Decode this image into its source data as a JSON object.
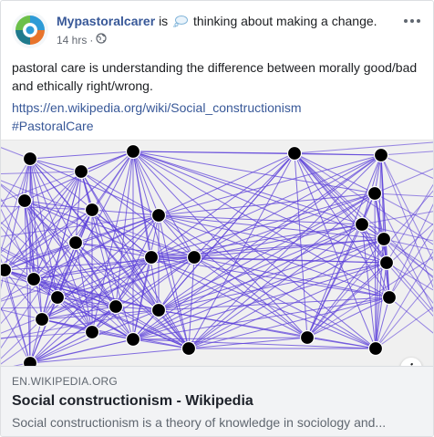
{
  "post": {
    "author": "Mypastoralcarer",
    "verb_is": "is",
    "feeling_emoji": "thought-balloon-icon",
    "feeling_text": "thinking about making a change.",
    "time": "14 hrs",
    "dot": "·",
    "privacy_icon": "globe-icon",
    "body": "pastoral care is understanding the difference between morally good/bad and ethically right/wrong.",
    "link_url": "https://en.wikipedia.org/wiki/Social_constructionism",
    "hashtag": "#PastoralCare"
  },
  "link_preview": {
    "domain": "EN.WIKIPEDIA.ORG",
    "title": "Social constructionism - Wikipedia",
    "description": "Social constructionism is a theory of knowledge in sociology and...",
    "info_icon": "info-icon",
    "image_node_color": "#000000",
    "image_edge_color": "#5b3fd9"
  },
  "colors": {
    "link": "#385898",
    "muted": "#616770",
    "meta_bg": "#f2f3f5"
  }
}
